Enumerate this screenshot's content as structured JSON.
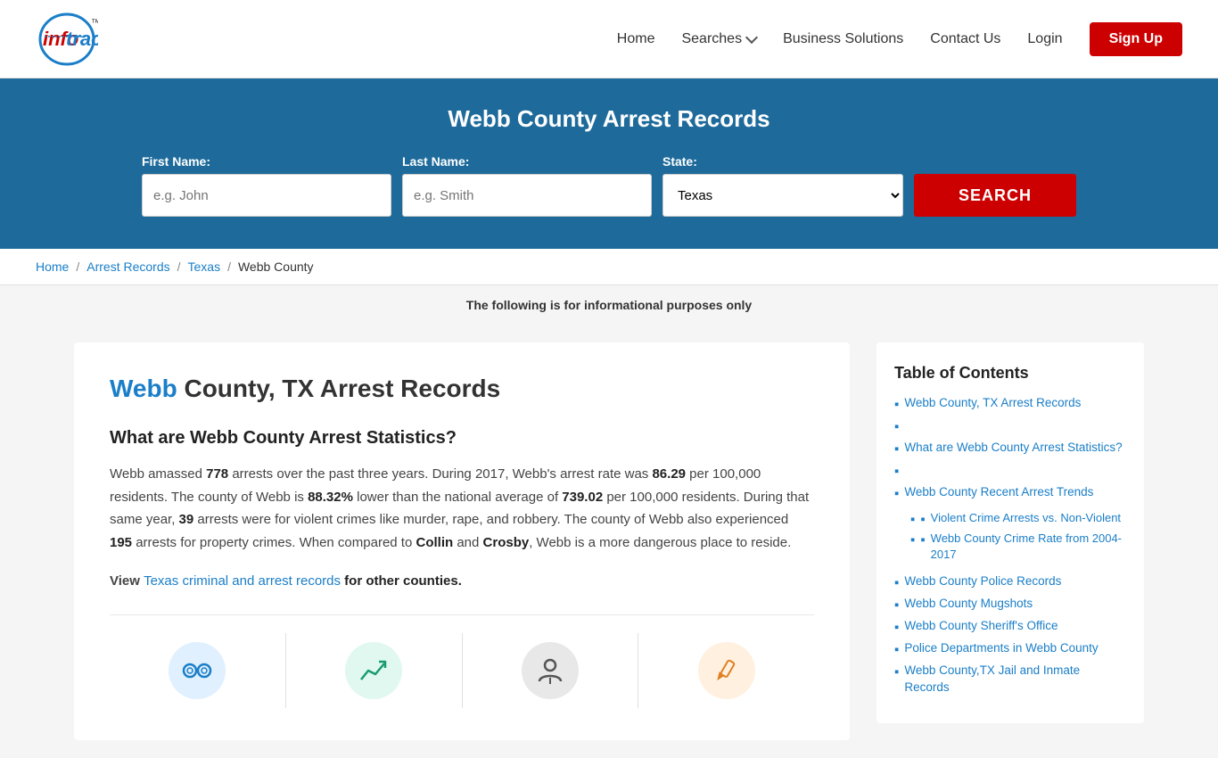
{
  "site": {
    "logo_info": "info",
    "logo_tracer": "tracer",
    "logo_tm": "™"
  },
  "nav": {
    "home_label": "Home",
    "searches_label": "Searches",
    "business_solutions_label": "Business Solutions",
    "contact_us_label": "Contact Us",
    "login_label": "Login",
    "signup_label": "Sign Up"
  },
  "hero": {
    "title": "Webb County Arrest Records",
    "first_name_label": "First Name:",
    "first_name_placeholder": "e.g. John",
    "last_name_label": "Last Name:",
    "last_name_placeholder": "e.g. Smith",
    "state_label": "State:",
    "state_value": "Texas",
    "search_button": "SEARCH"
  },
  "breadcrumb": {
    "home": "Home",
    "arrest_records": "Arrest Records",
    "texas": "Texas",
    "webb_county": "Webb County"
  },
  "disclaimer": "The following is for informational purposes only",
  "article": {
    "title_highlight": "Webb",
    "title_rest": " County, TX Arrest Records",
    "section1_title": "What are Webb County Arrest Statistics?",
    "body1": "Webb amassed ",
    "body_778": "778",
    "body2": " arrests over the past three years. During 2017, Webb's arrest rate was ",
    "body_8629": "86.29",
    "body3": " per 100,000 residents. The county of Webb is ",
    "body_8832": "88.32%",
    "body4": " lower than the national average of ",
    "body_73902": "739.02",
    "body5": " per 100,000 residents. During that same year, ",
    "body_39": "39",
    "body6": " arrests were for violent crimes like murder, rape, and robbery. The county of Webb also experienced ",
    "body_195": "195",
    "body7": " arrests for property crimes. When compared to ",
    "body_collin": "Collin",
    "body8": " and ",
    "body_crosby": "Crosby",
    "body9": ", Webb is a more dangerous place to reside.",
    "view_text": "View ",
    "view_link_text": "Texas criminal and arrest records",
    "view_after": " for other counties."
  },
  "toc": {
    "title": "Table of Contents",
    "items": [
      {
        "label": "Webb County, TX Arrest Records",
        "href": "#"
      },
      {
        "label": "What are Webb County Arrest Statistics?",
        "href": "#",
        "sub": []
      },
      {
        "label": "Webb County Recent Arrest Trends",
        "href": "#",
        "sub": [
          {
            "label": "Violent Crime Arrests vs. Non-Violent",
            "href": "#"
          },
          {
            "label": "Webb County Crime Rate from 2004-2017",
            "href": "#"
          }
        ]
      },
      {
        "label": "Webb County Police Records",
        "href": "#"
      },
      {
        "label": "Webb County Mugshots",
        "href": "#"
      },
      {
        "label": "Webb County Sheriff's Office",
        "href": "#"
      },
      {
        "label": "Police Departments in Webb County",
        "href": "#"
      },
      {
        "label": "Webb County,TX Jail and Inmate Records",
        "href": "#"
      }
    ]
  },
  "sidebar_toc_title": "Table of Contents",
  "toc_links": [
    "Webb County, TX Arrest Records",
    "What are Webb County Arrest Statistics?",
    "Webb County Recent Arrest Trends",
    "Violent Crime Arrests vs. Non-Violent",
    "Webb County Crime Rate from 2004-2017",
    "Webb County Police Records",
    "Webb County Mugshots",
    "Webb County Sheriff's Office",
    "Police Departments in Webb County",
    "Webb County,TX Jail and Inmate Records"
  ]
}
